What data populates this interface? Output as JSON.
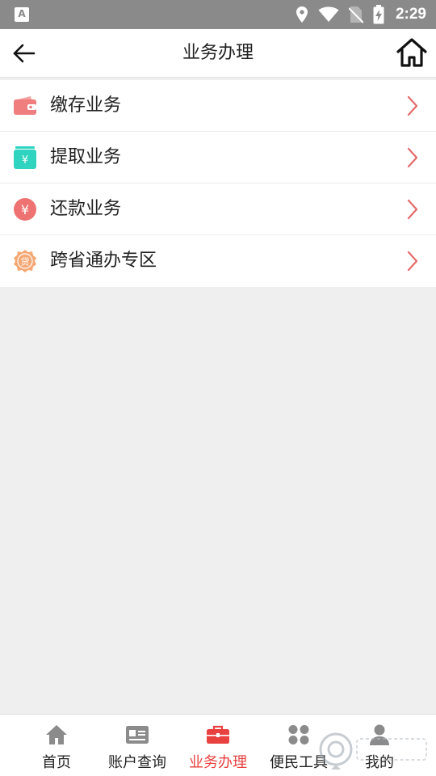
{
  "status_bar": {
    "time": "2:29",
    "app_icon": "A"
  },
  "header": {
    "title": "业务办理",
    "back_icon": "arrow-left-icon",
    "home_icon": "home-icon"
  },
  "menu": {
    "items": [
      {
        "label": "缴存业务",
        "icon": "wallet-icon",
        "color": "#f07e7e"
      },
      {
        "label": "提取业务",
        "icon": "yen-box-icon",
        "color": "#2ed4bf"
      },
      {
        "label": "还款业务",
        "icon": "yen-circle-icon",
        "color": "#ef7272"
      },
      {
        "label": "跨省通办专区",
        "icon": "loan-badge-icon",
        "color": "#f6a874"
      }
    ],
    "chevron_color": "#e46a6a"
  },
  "tabbar": {
    "tabs": [
      {
        "label": "首页",
        "icon": "home-icon"
      },
      {
        "label": "账户查询",
        "icon": "id-card-icon"
      },
      {
        "label": "业务办理",
        "icon": "briefcase-icon",
        "active": true
      },
      {
        "label": "便民工具",
        "icon": "grid-icon"
      },
      {
        "label": "我的",
        "icon": "user-icon"
      }
    ],
    "active_color": "#e8413f",
    "inactive_icon_color": "#8b8b8b"
  }
}
